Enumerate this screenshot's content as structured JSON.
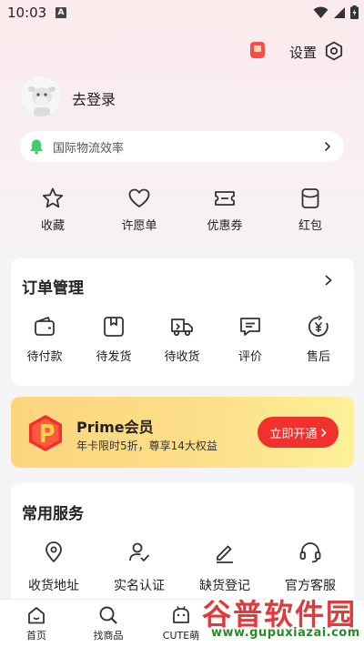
{
  "status_bar": {
    "time": "10:03",
    "notification_icon": "A"
  },
  "header": {
    "settings_label": "设置"
  },
  "profile": {
    "login_label": "去登录"
  },
  "notice": {
    "text": "国际物流效率"
  },
  "quick_actions": [
    {
      "label": "收藏",
      "icon": "star-icon"
    },
    {
      "label": "许愿单",
      "icon": "heart-icon"
    },
    {
      "label": "优惠券",
      "icon": "ticket-icon"
    },
    {
      "label": "红包",
      "icon": "red-packet-icon"
    }
  ],
  "orders": {
    "title": "订单管理",
    "items": [
      {
        "label": "待付款",
        "icon": "wallet-icon"
      },
      {
        "label": "待发货",
        "icon": "box-icon"
      },
      {
        "label": "待收货",
        "icon": "truck-icon"
      },
      {
        "label": "评价",
        "icon": "comment-icon"
      },
      {
        "label": "售后",
        "icon": "refund-icon"
      }
    ]
  },
  "prime": {
    "logo_letter": "P",
    "title": "Prime会员",
    "subtitle": "年卡限时5折，尊享14大权益",
    "button_label": "立即开通"
  },
  "services": {
    "title": "常用服务",
    "items": [
      {
        "label": "收货地址",
        "icon": "location-icon"
      },
      {
        "label": "实名认证",
        "icon": "user-verified-icon"
      },
      {
        "label": "缺货登记",
        "icon": "edit-icon"
      },
      {
        "label": "官方客服",
        "icon": "headset-icon"
      }
    ]
  },
  "bottom_nav": [
    {
      "label": "首页",
      "icon": "home-icon"
    },
    {
      "label": "找商品",
      "icon": "search-icon"
    },
    {
      "label": "CUTE萌",
      "icon": "cute-icon"
    }
  ],
  "watermark": {
    "title": "谷普软件园",
    "url": "www.gupuxiazai.com"
  },
  "colors": {
    "accent": "#f0312d",
    "prime_gold": "#fcd47e",
    "notice_bell": "#3fcf6a"
  }
}
